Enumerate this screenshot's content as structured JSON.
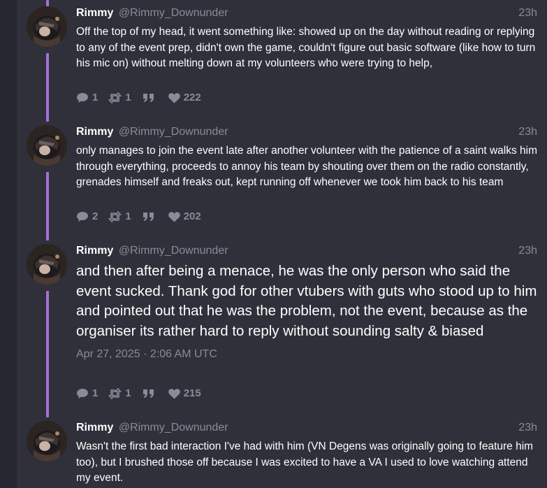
{
  "tweets": [
    {
      "fullname": "Rimmy",
      "username": "@Rimmy_Downunder",
      "date": "23h",
      "text": "Off the top of my head, it went something like: showed up on the day without reading or replying to any of the event prep, didn't own the game, couldn't figure out basic software (like how to turn his mic on) without melting down at my volunteers who were trying to help,",
      "stats": {
        "replies": "1",
        "retweets": "1",
        "likes": "222"
      },
      "icons": {
        "reply": "comment-icon",
        "retweet": "retweet-icon",
        "quote": "quote-icon",
        "like": "heart-icon"
      }
    },
    {
      "fullname": "Rimmy",
      "username": "@Rimmy_Downunder",
      "date": "23h",
      "text": "only manages to join the event late after another volunteer with the patience of a saint walks him through everything, proceeds to annoy his team by shouting over them on the radio constantly, grenades himself and freaks out, kept running off whenever we took him back to his team",
      "stats": {
        "replies": "2",
        "retweets": "1",
        "likes": "202"
      },
      "icons": {
        "reply": "comment-icon",
        "retweet": "retweet-icon",
        "quote": "quote-icon",
        "like": "heart-icon"
      }
    },
    {
      "fullname": "Rimmy",
      "username": "@Rimmy_Downunder",
      "date": "23h",
      "text": "and then after being a menace, he was the only person who said the event sucked. Thank god for other vtubers with guts who stood up to him and pointed out that he was the problem, not the event, because as the organiser its rather hard to reply without sounding salty & biased",
      "published": "Apr 27, 2025 · 2:06 AM UTC",
      "stats": {
        "replies": "1",
        "retweets": "1",
        "likes": "215"
      },
      "icons": {
        "reply": "comment-icon",
        "retweet": "retweet-icon",
        "quote": "quote-icon",
        "like": "heart-icon"
      }
    },
    {
      "fullname": "Rimmy",
      "username": "@Rimmy_Downunder",
      "date": "23h",
      "text": "Wasn't the first bad interaction I've had with him (VN Degens was originally going to feature him too), but I brushed those off because I was excited to have a VA I used to love watching attend my event."
    }
  ],
  "colors": {
    "background": "#262630",
    "timeline": "#2f3039",
    "thread_line": "#a370d8",
    "text": "#ffffff",
    "muted": "#8a8b99"
  }
}
